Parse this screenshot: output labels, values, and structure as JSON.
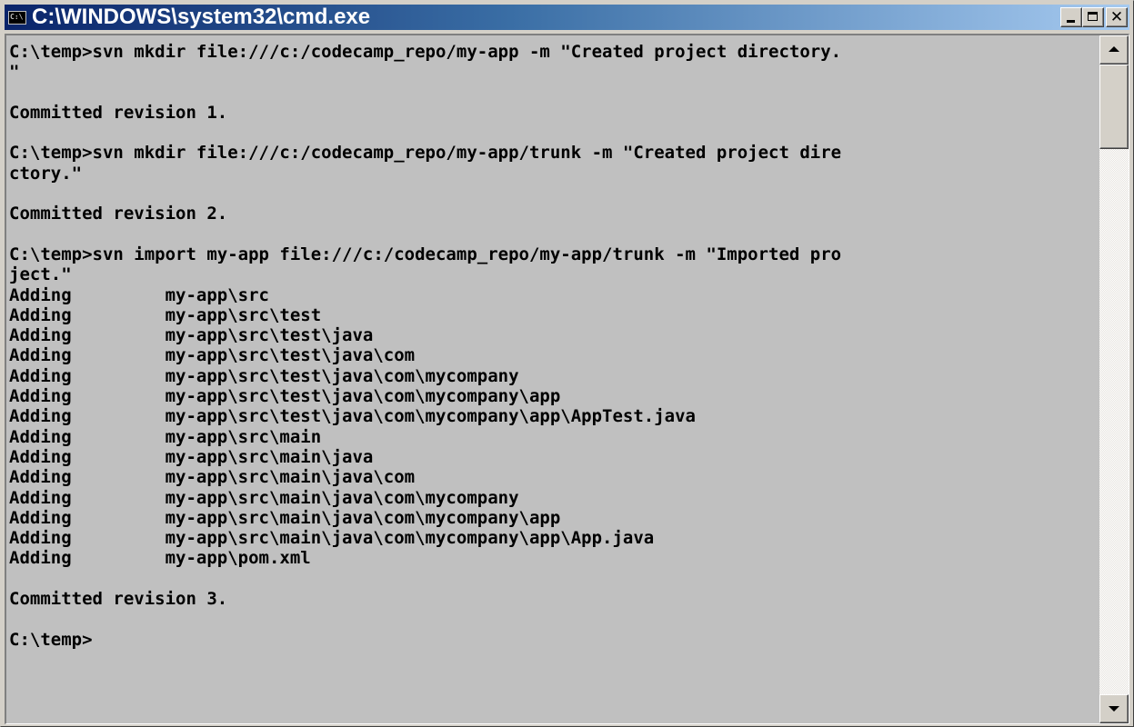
{
  "window": {
    "title": "C:\\WINDOWS\\system32\\cmd.exe",
    "icon": "cmd-icon",
    "icon_text": "C:\\",
    "controls": {
      "minimize": "minimize-icon",
      "maximize": "maximize-icon",
      "close": "close-icon",
      "close_glyph": "✕"
    }
  },
  "console": {
    "lines": [
      "C:\\temp>svn mkdir file:///c:/codecamp_repo/my-app -m \"Created project directory.",
      "\"",
      "",
      "Committed revision 1.",
      "",
      "C:\\temp>svn mkdir file:///c:/codecamp_repo/my-app/trunk -m \"Created project dire",
      "ctory.\"",
      "",
      "Committed revision 2.",
      "",
      "C:\\temp>svn import my-app file:///c:/codecamp_repo/my-app/trunk -m \"Imported pro",
      "ject.\"",
      "Adding         my-app\\src",
      "Adding         my-app\\src\\test",
      "Adding         my-app\\src\\test\\java",
      "Adding         my-app\\src\\test\\java\\com",
      "Adding         my-app\\src\\test\\java\\com\\mycompany",
      "Adding         my-app\\src\\test\\java\\com\\mycompany\\app",
      "Adding         my-app\\src\\test\\java\\com\\mycompany\\app\\AppTest.java",
      "Adding         my-app\\src\\main",
      "Adding         my-app\\src\\main\\java",
      "Adding         my-app\\src\\main\\java\\com",
      "Adding         my-app\\src\\main\\java\\com\\mycompany",
      "Adding         my-app\\src\\main\\java\\com\\mycompany\\app",
      "Adding         my-app\\src\\main\\java\\com\\mycompany\\app\\App.java",
      "Adding         my-app\\pom.xml",
      "",
      "Committed revision 3.",
      "",
      "C:\\temp>"
    ]
  },
  "scrollbar": {
    "up_icon": "arrow-up-icon",
    "down_icon": "arrow-down-icon"
  },
  "colors": {
    "title_gradient_start": "#0a246a",
    "title_gradient_end": "#a6caf0",
    "console_background": "#c0c0c0",
    "console_text": "#000000"
  }
}
